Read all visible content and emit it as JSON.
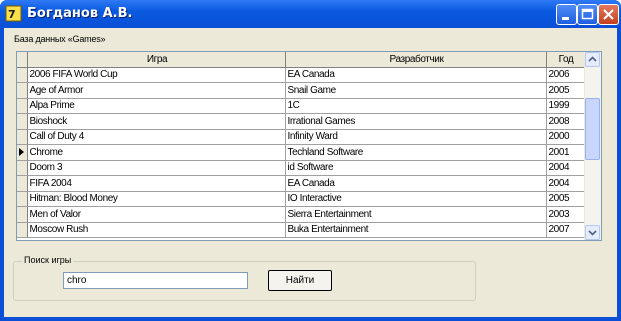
{
  "window": {
    "title": "Богданов А.В."
  },
  "db_label": "База данных «Games»",
  "grid": {
    "columns": [
      "Игра",
      "Разработчик",
      "Год"
    ],
    "rows": [
      [
        "2006 FIFA World Cup",
        "EA Canada",
        "2006"
      ],
      [
        "Age of Armor",
        "Snail Game",
        "2005"
      ],
      [
        "Alpa Prime",
        "1С",
        "1999"
      ],
      [
        "Bioshock",
        "Irrational Games",
        "2008"
      ],
      [
        "Call of Duty 4",
        "Infinity Ward",
        "2000"
      ],
      [
        "Chrome",
        "Techland Software",
        "2001"
      ],
      [
        "Doom 3",
        "id Software",
        "2004"
      ],
      [
        "FIFA 2004",
        "EA Canada",
        "2004"
      ],
      [
        "Hitman: Blood Money",
        "IO Interactive",
        "2005"
      ],
      [
        "Men of Valor",
        "Sierra Entertainment",
        "2003"
      ],
      [
        "Moscow Rush",
        "Buka Entertainment",
        "2007"
      ]
    ],
    "current_row": 5
  },
  "search": {
    "group_label": "Поиск игры",
    "value": "chro",
    "button_label": "Найти"
  }
}
